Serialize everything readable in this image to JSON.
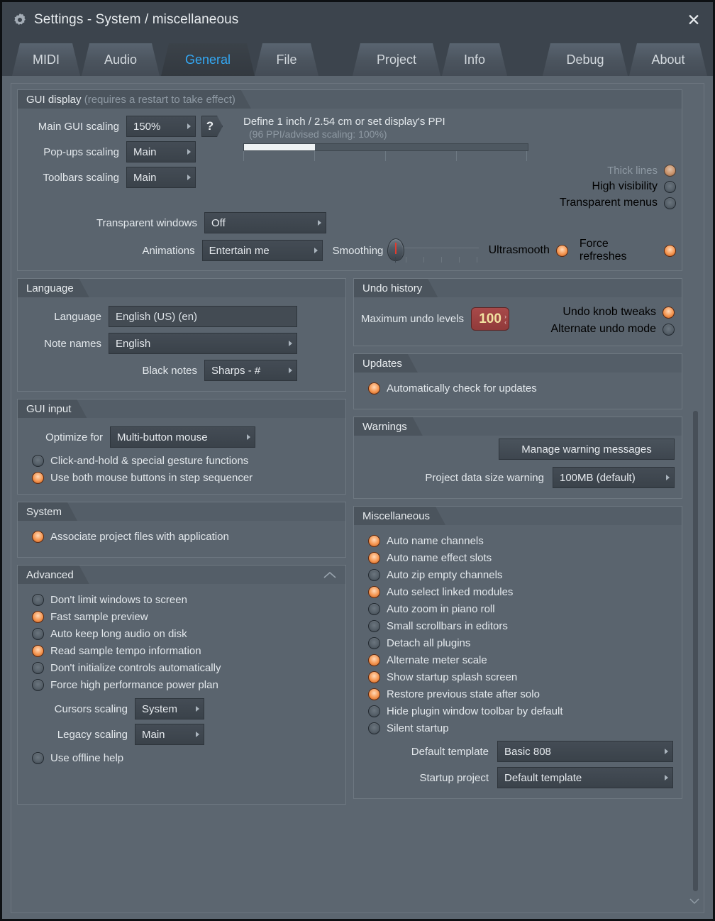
{
  "window": {
    "title": "Settings - System / miscellaneous",
    "gear_icon": "gear-icon",
    "close_label": "✕"
  },
  "tabs": [
    {
      "label": "MIDI",
      "selected": false
    },
    {
      "label": "Audio",
      "selected": false
    },
    {
      "label": "General",
      "selected": true
    },
    {
      "label": "File",
      "selected": false
    },
    {
      "label": "Project",
      "selected": false
    },
    {
      "label": "Info",
      "selected": false
    },
    {
      "label": "Debug",
      "selected": false
    },
    {
      "label": "About",
      "selected": false
    }
  ],
  "gui_display": {
    "title": "GUI display",
    "subtitle": "(requires a restart to take effect)",
    "main_gui_scaling": {
      "label": "Main GUI scaling",
      "value": "150%"
    },
    "popups_scaling": {
      "label": "Pop-ups scaling",
      "value": "Main"
    },
    "toolbars_scaling": {
      "label": "Toolbars scaling",
      "value": "Main"
    },
    "help_button": "?",
    "ppi_line1": "Define 1 inch / 2.54 cm or set display's PPI",
    "ppi_line2": "(96 PPI/advised scaling: 100%)",
    "ruler_fill_percent": 25,
    "transparent_windows": {
      "label": "Transparent windows",
      "value": "Off"
    },
    "animations": {
      "label": "Animations",
      "value": "Entertain me"
    },
    "smoothing_label": "Smoothing",
    "toggles": [
      {
        "label": "Thick lines",
        "on": true,
        "disabled": true
      },
      {
        "label": "High visibility",
        "on": false,
        "disabled": false
      },
      {
        "label": "Transparent menus",
        "on": false,
        "disabled": false
      }
    ],
    "ultrasmooth": {
      "label": "Ultrasmooth",
      "on": true
    },
    "force_refreshes": {
      "label": "Force refreshes",
      "on": true
    }
  },
  "language": {
    "title": "Language",
    "language": {
      "label": "Language",
      "value": "English (US) (en)"
    },
    "note_names": {
      "label": "Note names",
      "value": "English"
    },
    "black_notes": {
      "label": "Black notes",
      "value": "Sharps  - #"
    }
  },
  "gui_input": {
    "title": "GUI input",
    "optimize_for": {
      "label": "Optimize for",
      "value": "Multi-button mouse"
    },
    "options": [
      {
        "label": "Click-and-hold & special gesture functions",
        "on": false
      },
      {
        "label": "Use both mouse buttons in step sequencer",
        "on": true
      }
    ]
  },
  "system": {
    "title": "System",
    "options": [
      {
        "label": "Associate project files with application",
        "on": true
      }
    ]
  },
  "advanced": {
    "title": "Advanced",
    "collapse_icon": "chevron-up-icon",
    "options": [
      {
        "label": "Don't limit windows to screen",
        "on": false
      },
      {
        "label": "Fast sample preview",
        "on": true
      },
      {
        "label": "Auto keep long audio on disk",
        "on": false
      },
      {
        "label": "Read sample tempo information",
        "on": true
      },
      {
        "label": "Don't initialize controls automatically",
        "on": false
      },
      {
        "label": "Force high performance power plan",
        "on": false
      }
    ],
    "cursors_scaling": {
      "label": "Cursors scaling",
      "value": "System"
    },
    "legacy_scaling": {
      "label": "Legacy scaling",
      "value": "Main"
    },
    "offline_help": {
      "label": "Use offline help",
      "on": false
    }
  },
  "undo_history": {
    "title": "Undo history",
    "max_undo_label": "Maximum undo levels",
    "max_undo_value": "100",
    "toggles": [
      {
        "label": "Undo knob tweaks",
        "on": true
      },
      {
        "label": "Alternate undo mode",
        "on": false
      }
    ]
  },
  "updates": {
    "title": "Updates",
    "options": [
      {
        "label": "Automatically check for updates",
        "on": true
      }
    ]
  },
  "warnings": {
    "title": "Warnings",
    "manage_button": "Manage warning messages",
    "project_size": {
      "label": "Project data size warning",
      "value": "100MB (default)"
    }
  },
  "miscellaneous": {
    "title": "Miscellaneous",
    "options": [
      {
        "label": "Auto name channels",
        "on": true
      },
      {
        "label": "Auto name effect slots",
        "on": true
      },
      {
        "label": "Auto zip empty channels",
        "on": false
      },
      {
        "label": "Auto select linked modules",
        "on": true
      },
      {
        "label": "Auto zoom in piano roll",
        "on": false
      },
      {
        "label": "Small scrollbars in editors",
        "on": false
      },
      {
        "label": "Detach all plugins",
        "on": false
      },
      {
        "label": "Alternate meter scale",
        "on": true
      },
      {
        "label": "Show startup splash screen",
        "on": true
      },
      {
        "label": "Restore previous state after solo",
        "on": true
      },
      {
        "label": "Hide plugin window toolbar by default",
        "on": false
      },
      {
        "label": "Silent startup",
        "on": false
      }
    ],
    "default_template": {
      "label": "Default template",
      "value": "Basic 808"
    },
    "startup_project": {
      "label": "Startup project",
      "value": "Default template"
    }
  },
  "scrollbar": {
    "down_icon": "chevron-down-icon"
  },
  "colors": {
    "window_bg": "#5c6670",
    "titlebar_bg": "#3c444d",
    "accent_tab": "#34a9f5",
    "led_on": "#f5954f",
    "numbox_bg": "#a84a4a",
    "numbox_text": "#f2e2a0"
  }
}
